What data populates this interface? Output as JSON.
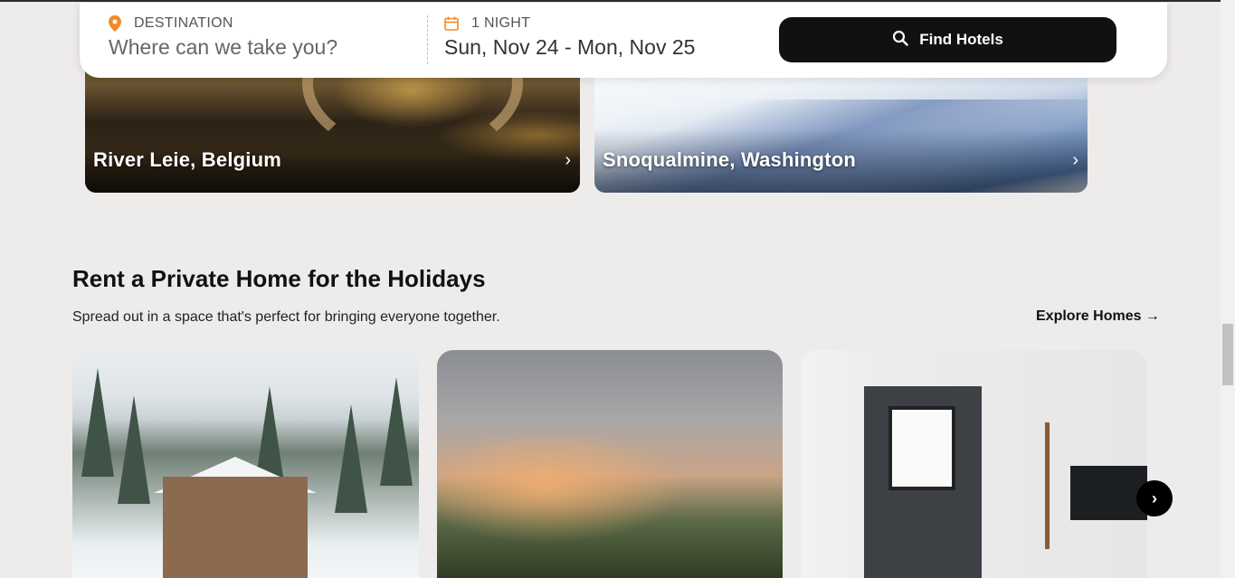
{
  "search": {
    "destination_label": "DESTINATION",
    "destination_placeholder": "Where can we take you?",
    "nights_label": "1 NIGHT",
    "dates_value": "Sun, Nov 24 - Mon, Nov 25",
    "find_button_label": "Find Hotels",
    "destination_icon": "map-pin-icon",
    "calendar_icon": "calendar-icon",
    "find_icon": "search-icon"
  },
  "destinations": [
    {
      "name": "River Leie, Belgium",
      "chevron": "›"
    },
    {
      "name": "Snoqualmine, Washington",
      "chevron": "›"
    }
  ],
  "homes_section": {
    "title": "Rent a Private Home for the Holidays",
    "subtitle": "Spread out in a space that's perfect for bringing everyone together.",
    "explore_link": "Explore Homes →",
    "next_button": "›"
  },
  "colors": {
    "accent_orange": "#f08a24",
    "button_black": "#111111",
    "page_bg": "#eeebeb"
  }
}
